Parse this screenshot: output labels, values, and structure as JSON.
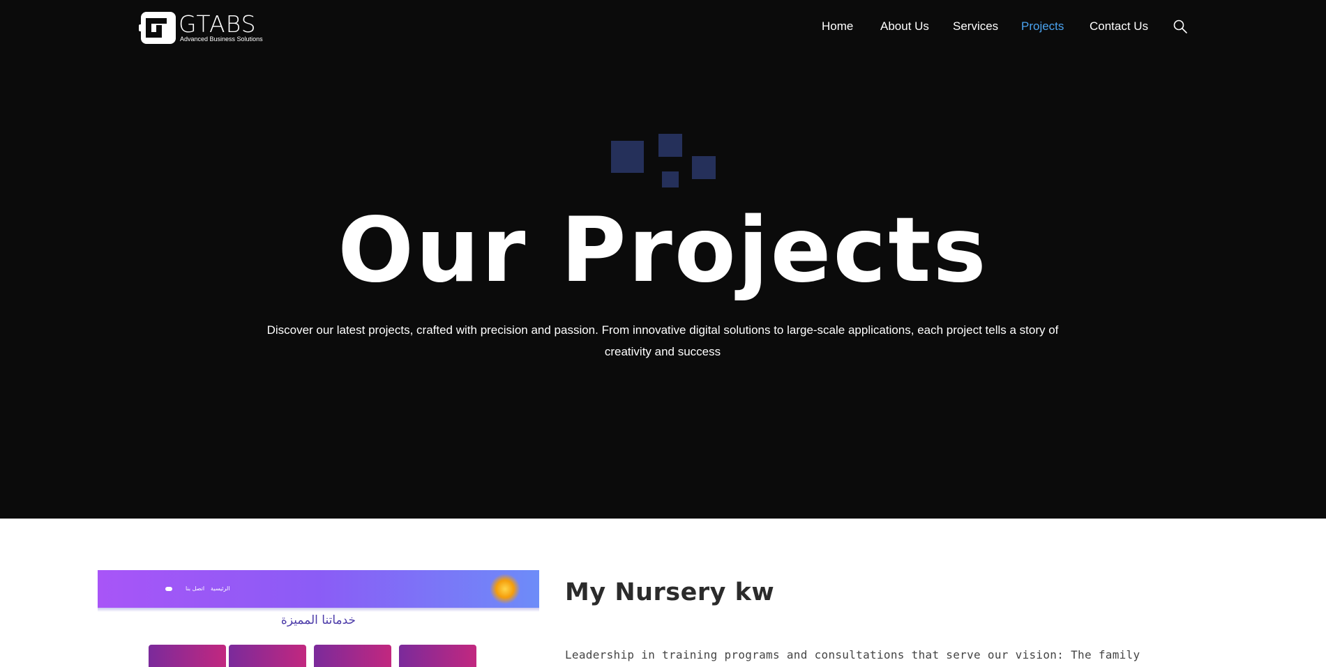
{
  "header": {
    "logo": {
      "name": "GTABS",
      "tagline": "Advanced Business Solutions",
      "mark_text": "GT"
    },
    "nav": [
      {
        "label": "Home",
        "active": false
      },
      {
        "label": "About Us",
        "active": false
      },
      {
        "label": "Services",
        "active": false
      },
      {
        "label": "Projects",
        "active": true
      },
      {
        "label": "Contact Us",
        "active": false
      }
    ],
    "search_icon": "search-icon"
  },
  "hero": {
    "title": "Our Projects",
    "description": "Discover our latest projects, crafted with precision and passion. From innovative digital solutions to large-scale applications, each project tells a story of creativity and success"
  },
  "projects": [
    {
      "title": "My Nursery kw",
      "description": "Leadership in training programs and consultations that serve our vision: The family",
      "preview": {
        "nav_items": [
          "الرئيسية",
          "اتصل بنا"
        ],
        "heading": "خدماتنا المميزة"
      }
    }
  ],
  "colors": {
    "background_dark": "#0b0b0b",
    "accent": "#4aa3f0",
    "decor_squares": "#25305a"
  }
}
